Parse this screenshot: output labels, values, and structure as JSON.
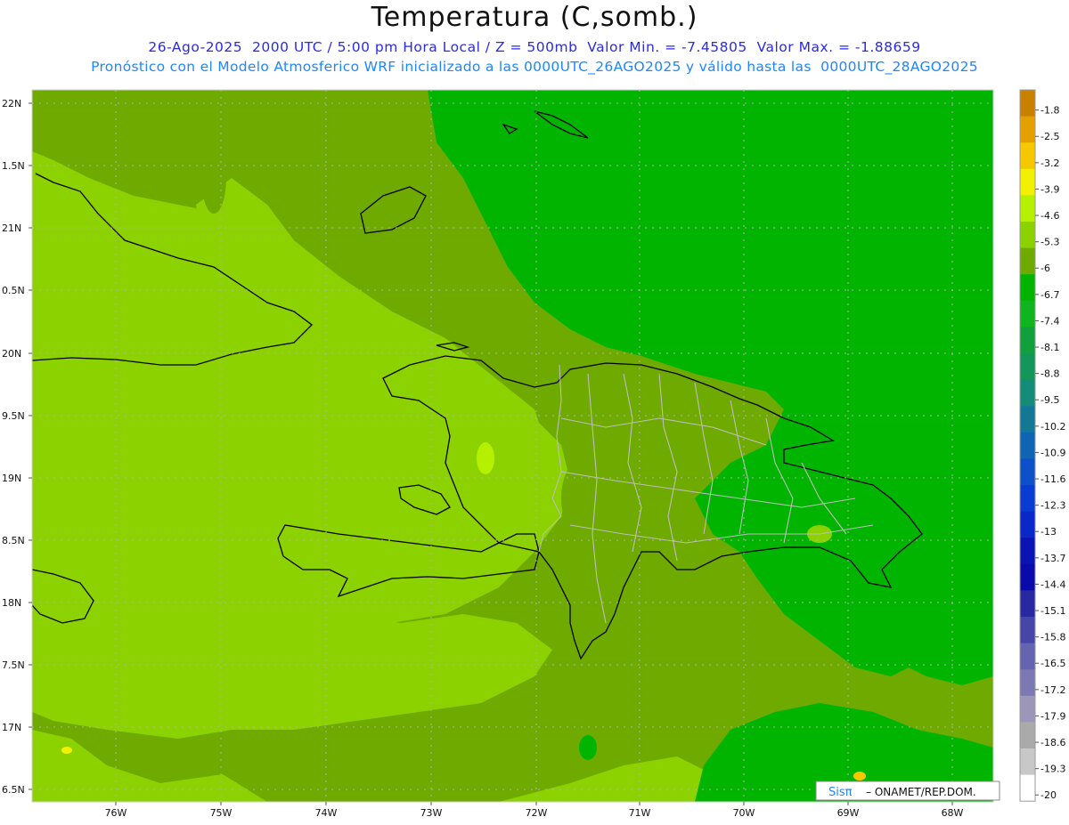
{
  "header": {
    "title": "Temperatura (C,somb.)",
    "subtitle_line1": "26-Ago-2025  2000 UTC / 5:00 pm Hora Local / Z = 500mb  Valor Min. = -7.45805  Valor Max. = -1.88659",
    "subtitle_line2": "Pronóstico con el Modelo Atmosferico WRF inicializado a las 0000UTC_26AGO2025 y válido hasta las  0000UTC_28AGO2025"
  },
  "map": {
    "latitude_labels": [
      "22N",
      "1.5N",
      "21N",
      "0.5N",
      "20N",
      "9.5N",
      "19N",
      "8.5N",
      "18N",
      "7.5N",
      "17N",
      "6.5N"
    ],
    "longitude_labels": [
      "76W",
      "75W",
      "74W",
      "73W",
      "72W",
      "71W",
      "70W",
      "69W",
      "68W"
    ]
  },
  "colorbar": {
    "labels": [
      "-1.8",
      "-2.5",
      "-3.2",
      "-3.9",
      "-4.6",
      "-5.3",
      "-6",
      "-6.7",
      "-7.4",
      "-8.1",
      "-8.8",
      "-9.5",
      "-10.2",
      "-10.9",
      "-11.6",
      "-12.3",
      "-13",
      "-13.7",
      "-14.4",
      "-15.1",
      "-15.8",
      "-16.5",
      "-17.2",
      "-17.9",
      "-18.6",
      "-19.3",
      "-20"
    ],
    "colors": [
      "#c88000",
      "#e4a000",
      "#f5c800",
      "#f0f000",
      "#b4f000",
      "#8cd200",
      "#6eaa00",
      "#00b400",
      "#10b41e",
      "#12a03c",
      "#14965a",
      "#148c78",
      "#127896",
      "#1064b4",
      "#0e50c8",
      "#0a3cd2",
      "#0a28c8",
      "#0a14b4",
      "#0a0aaa",
      "#2828a0",
      "#4646a8",
      "#6464b0",
      "#7c78b4",
      "#9c96b8",
      "#aaaaaa",
      "#c8c8c8",
      "#ffffff"
    ]
  },
  "credit": {
    "prefix": "Sisπ",
    "text": "–  ONAMET/REP.DOM."
  }
}
